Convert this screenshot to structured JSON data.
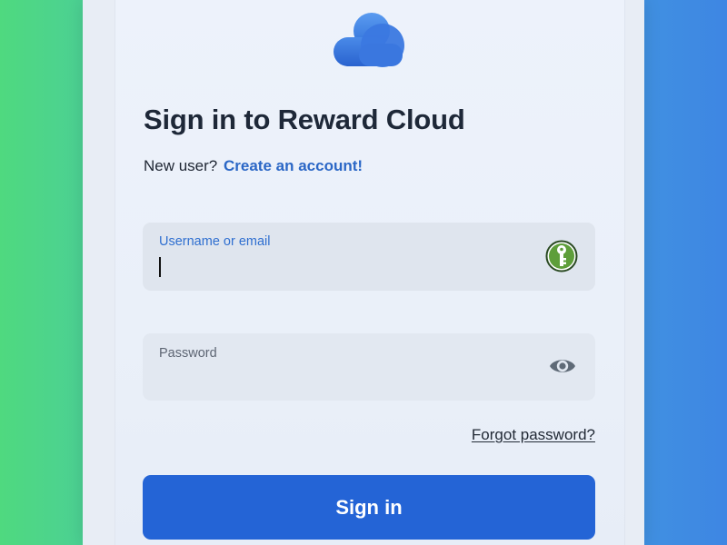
{
  "logo": {
    "icon": "cloud-icon",
    "colors": [
      "#3a7fe6",
      "#2f6cd6"
    ]
  },
  "title": "Sign in to Reward Cloud",
  "signup": {
    "prompt": "New user?",
    "link_text": "Create an account!"
  },
  "username_field": {
    "label": "Username or email",
    "value": "",
    "trailing_icon": "key-icon"
  },
  "password_field": {
    "label": "Password",
    "value": "",
    "trailing_icon": "eye-icon"
  },
  "forgot_password": "Forgot password?",
  "submit": {
    "label": "Sign in"
  },
  "colors": {
    "accent": "#2464d6",
    "link": "#2b67c6",
    "background_left": "#4fd97f",
    "background_right": "#3e86e3"
  }
}
